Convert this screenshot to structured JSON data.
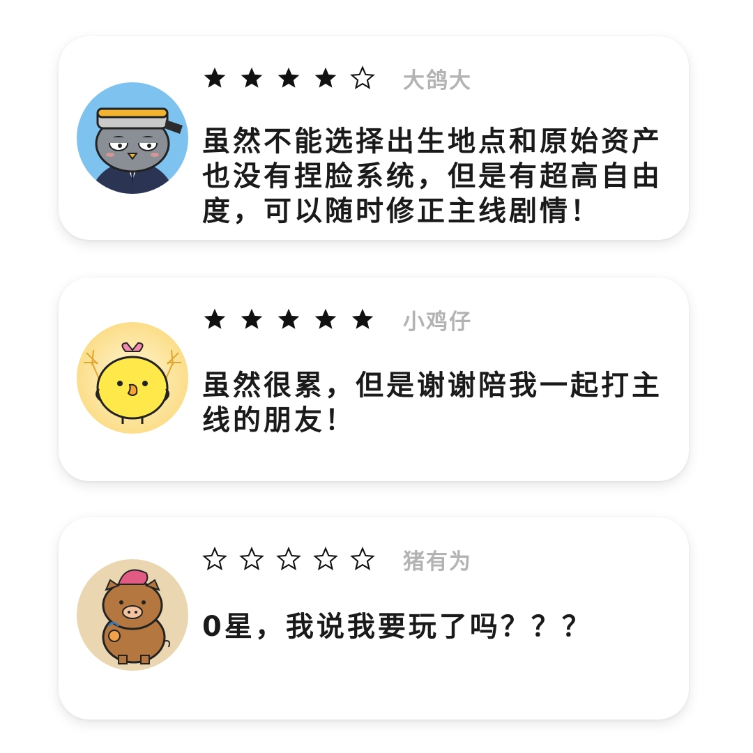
{
  "reviews": [
    {
      "username": "大鸽大",
      "rating": 4,
      "max_rating": 5,
      "avatar_icon": "pigeon-with-hat-icon",
      "avatar_bg": "#7ec3f0",
      "text": "虽然不能选择出生地点和原始资产\n也没有捏脸系统，但是有超高自由\n度，可以随时修正主线剧情！"
    },
    {
      "username": "小鸡仔",
      "rating": 5,
      "max_rating": 5,
      "avatar_icon": "chick-with-sparklers-icon",
      "avatar_bg": "#fce7a6",
      "text": "虽然很累，但是谢谢陪我一起打主\n线的朋友！"
    },
    {
      "username": "猪有为",
      "rating": 0,
      "max_rating": 5,
      "avatar_icon": "pig-with-mohawk-icon",
      "avatar_bg": "#ead6b0",
      "text": "0星，我说我要玩了吗？？？"
    }
  ],
  "colors": {
    "star": "#111111",
    "username": "#b3b3b3",
    "text": "#1a1a1a"
  }
}
